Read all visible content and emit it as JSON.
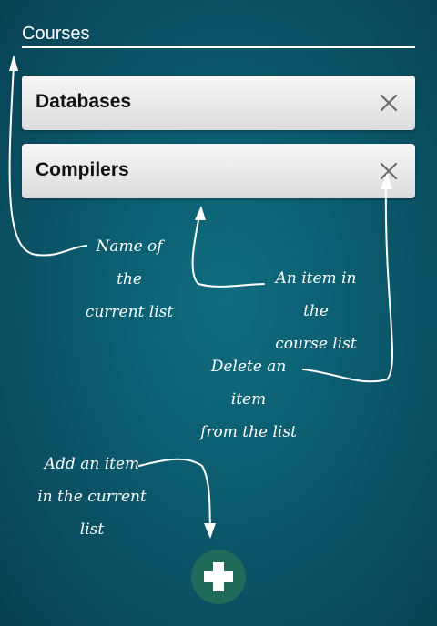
{
  "header": {
    "title": "Courses"
  },
  "courses": [
    {
      "name": "Databases"
    },
    {
      "name": "Compilers"
    }
  ],
  "annotations": {
    "list_name": [
      "Name of the",
      "current list"
    ],
    "item": [
      "An item in the",
      "course list"
    ],
    "delete": [
      "Delete an item",
      "from the list"
    ],
    "add": [
      "Add an item",
      "in the current list"
    ]
  },
  "icons": {
    "delete": "close-icon",
    "add": "plus-icon"
  },
  "colors": {
    "background": "#0b5a6d",
    "add_button": "#1f6a58",
    "card": "#eeeeee"
  }
}
